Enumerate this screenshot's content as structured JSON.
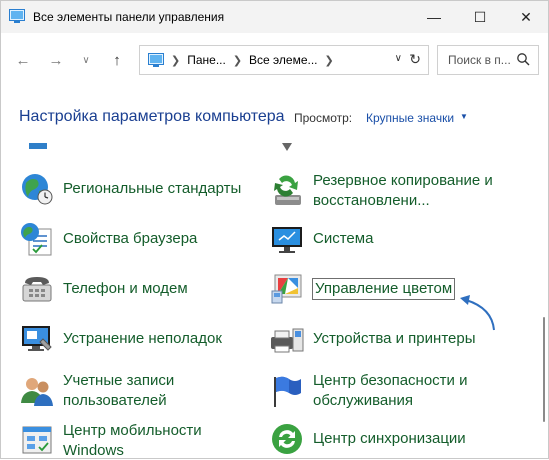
{
  "window": {
    "title": "Все элементы панели управления",
    "controls": {
      "minimize": "—",
      "maximize": "☐",
      "close": "✕"
    }
  },
  "nav": {
    "back_icon": "arrow-left",
    "forward_icon": "arrow-right",
    "recent_icon": "chevron-down",
    "up_icon": "arrow-up",
    "breadcrumb": [
      "Пане...",
      "Все элеме..."
    ],
    "search_placeholder": "Поиск в п..."
  },
  "header": {
    "title": "Настройка параметров компьютера",
    "view_label": "Просмотр:",
    "view_value": "Крупные значки"
  },
  "items": [
    {
      "id": "regional",
      "label": "Региональные стандарты",
      "icon": "globe-clock-icon"
    },
    {
      "id": "backup",
      "label_line1": "Резервное копирование и",
      "label_line2": "восстановлени...",
      "icon": "backup-icon"
    },
    {
      "id": "internet-options",
      "label": "Свойства браузера",
      "icon": "browser-settings-icon"
    },
    {
      "id": "system",
      "label": "Система",
      "icon": "system-monitor-icon"
    },
    {
      "id": "phone-modem",
      "label": "Телефон и модем",
      "icon": "phone-icon"
    },
    {
      "id": "color-management",
      "label": "Управление цветом",
      "icon": "color-monitor-icon",
      "selected": true
    },
    {
      "id": "troubleshooting",
      "label": "Устранение неполадок",
      "icon": "troubleshoot-icon"
    },
    {
      "id": "devices-printers",
      "label": "Устройства и принтеры",
      "icon": "printer-icon"
    },
    {
      "id": "user-accounts",
      "label_line1": "Учетные записи",
      "label_line2": "пользователей",
      "icon": "users-icon"
    },
    {
      "id": "security-center",
      "label_line1": "Центр безопасности и",
      "label_line2": "обслуживания",
      "icon": "flag-icon"
    },
    {
      "id": "mobility-center",
      "label_line1": "Центр мобильности",
      "label_line2": "Windows",
      "icon": "mobility-icon"
    },
    {
      "id": "sync-center",
      "label": "Центр синхронизации",
      "icon": "sync-icon"
    }
  ],
  "colors": {
    "link_green": "#145d2b",
    "title_blue": "#1a3f91",
    "accent_blue": "#1a4fa8",
    "annotation_arrow": "#2f6fbf"
  }
}
